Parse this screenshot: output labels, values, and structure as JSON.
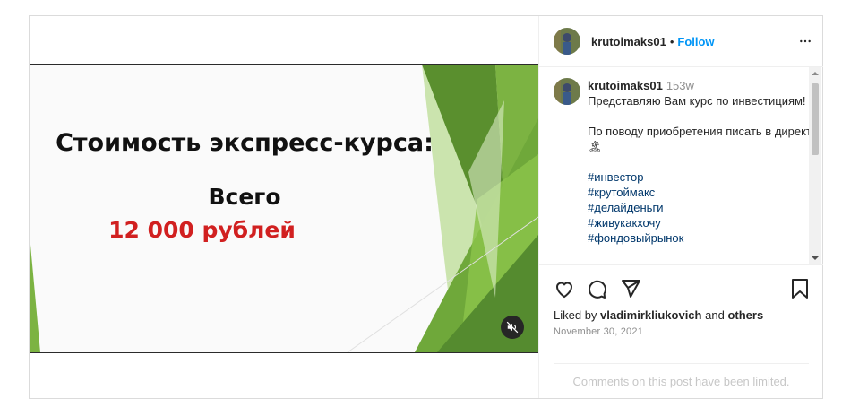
{
  "post": {
    "username": "krutoimaks01",
    "separator": "•",
    "follow_label": "Follow",
    "more_icon": "more-horizontal-icon"
  },
  "slide": {
    "title": "Стоимость экспресс-курса:",
    "line2": "Всего",
    "price": "12 000 рублей",
    "price_color": "#d12020",
    "accent_colors": [
      "#5a8f2e",
      "#7cb342",
      "#9ccc65",
      "#c5e1a5"
    ]
  },
  "caption": {
    "username": "krutoimaks01",
    "time": "153w",
    "line1": "Представляю Вам курс по инвестициям!",
    "line2": "По поводу приобретения писать в директ 🏝",
    "hashtags": [
      "#инвестор",
      "#крутоймакс",
      "#делайденьги",
      "#живукакхочу",
      "#фондовыйрынок"
    ]
  },
  "footer": {
    "liked_prefix": "Liked by",
    "liked_user": "vladimirkliukovich",
    "liked_and": "and",
    "liked_others": "others",
    "date": "November 30, 2021",
    "comments_limited": "Comments on this post have been limited."
  }
}
